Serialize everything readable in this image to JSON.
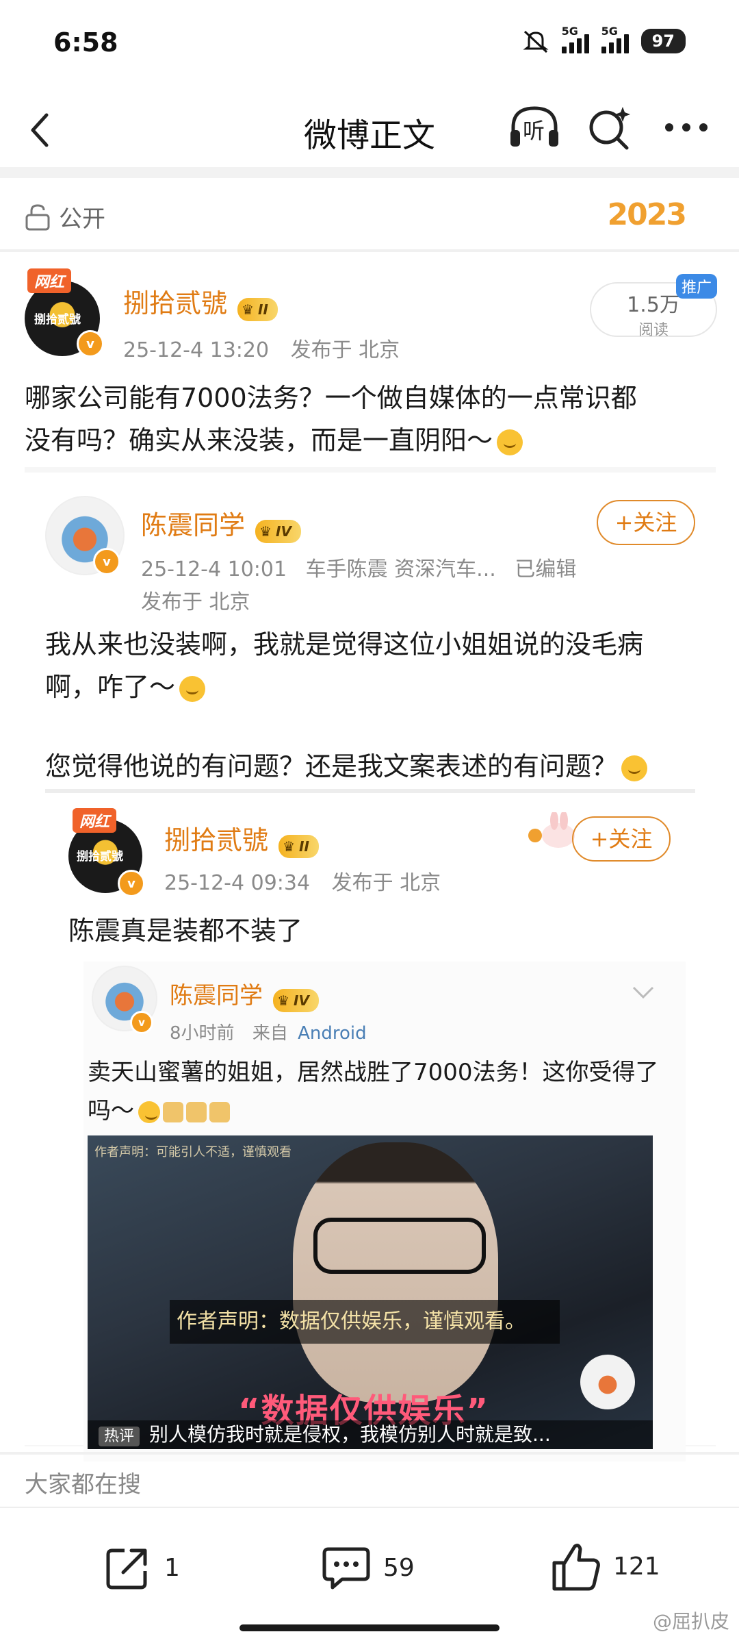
{
  "status_bar": {
    "time": "6:58",
    "signal1": "5G",
    "signal2": "5G",
    "battery": "97"
  },
  "nav": {
    "title": "微博正文",
    "listen_label": "听"
  },
  "visibility": {
    "label": "公开",
    "year_decoration": "2023"
  },
  "post": {
    "tag": "网红",
    "avatar_text": "捌拾贰號",
    "author": "捌拾贰號",
    "level": "II",
    "time": "25-12-4 13:20",
    "location": "发布于 北京",
    "read_count": "1.5万",
    "read_label": "阅读",
    "promo": "推广",
    "text_line1": "哪家公司能有7000法务？一个做自媒体的一点常识都",
    "text_line2": "没有吗？确实从来没装，而是一直阴阳～"
  },
  "repost1": {
    "author": "陈震同学",
    "level": "IV",
    "time": "25-12-4 10:01",
    "source": "车手陈震 资深汽车...",
    "edited": "已编辑",
    "location": "发布于 北京",
    "follow_label": "+关注",
    "text_line1": "我从来也没装啊，我就是觉得这位小姐姐说的没毛病",
    "text_line2": "啊，咋了～",
    "text_line3": "您觉得他说的有问题？还是我文案表述的有问题？"
  },
  "repost2": {
    "tag": "网红",
    "avatar_text": "捌拾贰號",
    "author": "捌拾贰號",
    "level": "II",
    "time": "25-12-4 09:34",
    "location": "发布于 北京",
    "follow_label": "+关注",
    "text": "陈震真是装都不装了"
  },
  "original": {
    "author": "陈震同学",
    "level": "IV",
    "time": "8小时前",
    "source_prefix": "来自",
    "source": "Android",
    "text_line1": "卖天山蜜薯的姐姐，居然战胜了7000法务！这你受得了",
    "text_line2": "吗～",
    "image": {
      "author_note": "作者声明：可能引人不适，谨慎观看",
      "caption": "作者声明：数据仅供娱乐，谨慎观看。",
      "big_text": "“数据仅供娱乐”",
      "hot_tag": "热评",
      "hot_comment": "别人模仿我时就是侵权，我模仿别人时就是致..."
    }
  },
  "search_section": {
    "label": "大家都在搜"
  },
  "actions": {
    "share": "1",
    "comment": "59",
    "like": "121"
  },
  "watermark": "@屈扒皮"
}
